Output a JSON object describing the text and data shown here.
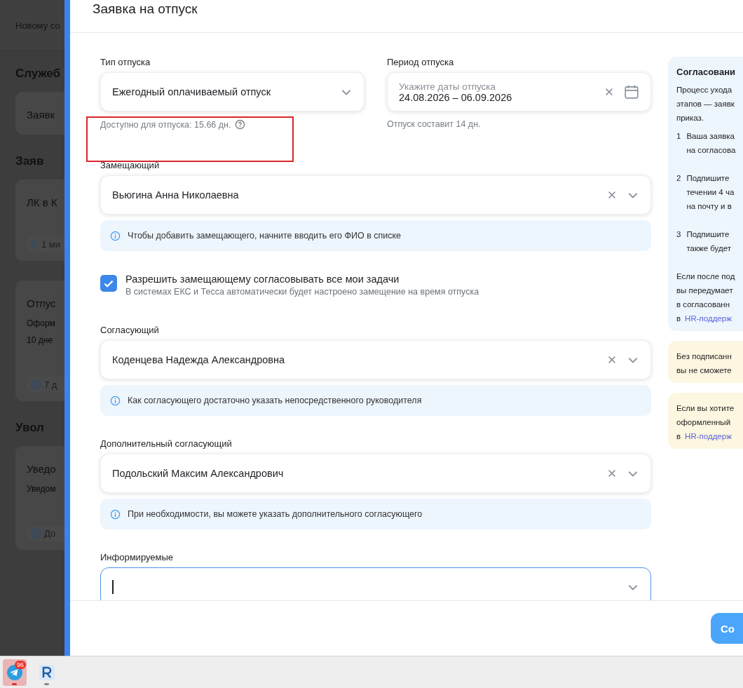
{
  "background": {
    "top_link": "Новому со",
    "sections": [
      {
        "title": "Служеб",
        "cards": [
          {
            "title": "Заявк"
          }
        ]
      },
      {
        "title": "Заяв",
        "cards": [
          {
            "title": "ЛК в К",
            "meta": "1 ми"
          },
          {
            "title": "Отпус",
            "description": [
              "Оформ",
              "10 дне"
            ],
            "meta": "7 д"
          }
        ]
      },
      {
        "title": "Увол",
        "cards": [
          {
            "title": "Уведо",
            "description": [
              "Уведом"
            ],
            "meta": "До"
          }
        ]
      }
    ]
  },
  "modal": {
    "title": "Заявка на отпуск",
    "leave_type": {
      "label": "Тип отпуска",
      "value": "Ежегодный оплачиваемый отпуск",
      "available": "Доступно для отпуска: 15.66 дн.",
      "highlighted": true
    },
    "period": {
      "label": "Период отпуска",
      "placeholder": "Укажите даты отпуска",
      "value": "24.08.2026 – 06.09.2026",
      "note": "Отпуск составит 14 дн."
    },
    "rows": [
      {
        "kind": "person",
        "label": "Замещающий",
        "value": "Вьюгина Анна Николаевна",
        "info": "Чтобы добавить замещающего, начните вводить его ФИО в списке",
        "focused": false
      },
      {
        "kind": "checkbox",
        "checked": true,
        "label": "Разрешить замещающему согласовывать все мои задачи",
        "description": "В системах ЕКС и Тесса автоматически будет настроено замещение на время отпуска"
      },
      {
        "kind": "person",
        "label": "Согласующий",
        "value": "Коденцева Надежда Александровна",
        "info": "Как согласующего достаточно указать непосредственного руководителя",
        "focused": false
      },
      {
        "kind": "person",
        "label": "Дополнительный согласующий",
        "value": "Подольский Максим Александрович",
        "info": "При необходимости, вы можете указать дополнительного согласующего",
        "focused": false
      },
      {
        "kind": "person",
        "label": "Информируемые",
        "focused": true
      }
    ],
    "side": {
      "title": "Согласовани",
      "intro": [
        "Процесс ухода",
        "этапов — заявк",
        "приказ."
      ],
      "steps": [
        {
          "num": "1",
          "lines": [
            "Ваша заявка",
            "на согласова"
          ]
        },
        {
          "num": "2",
          "lines": [
            "Подпишите",
            "течении 4 ча",
            "на почту и в"
          ]
        },
        {
          "num": "3",
          "lines": [
            "Подпишите",
            "также будет"
          ]
        }
      ],
      "outro": [
        "Если после под",
        "вы передумает",
        "в согласованн"
      ],
      "link_prefix": "в",
      "link": "HR-поддерж"
    },
    "notes": [
      {
        "lines": [
          "Без подписанн",
          "вы не сможете"
        ]
      },
      {
        "lines": [
          "Если вы хотите",
          "оформленный"
        ],
        "link_prefix": "в",
        "link": "HR-поддерж"
      }
    ],
    "submit": "Со"
  },
  "taskbar": {
    "apps": [
      {
        "kind": "telegram",
        "badge": "96",
        "active": true
      },
      {
        "kind": "r-app",
        "active": false
      }
    ]
  }
}
